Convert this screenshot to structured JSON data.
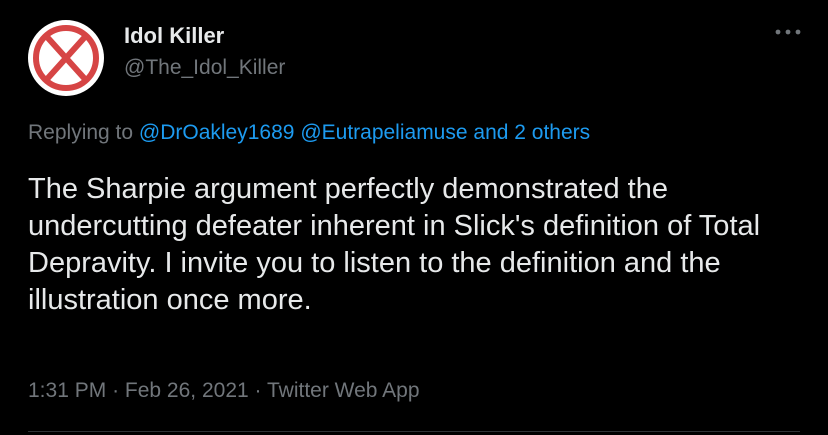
{
  "tweet": {
    "display_name": "Idol Killer",
    "handle": "@The_Idol_Killer",
    "avatar_icon": "red-x-icon",
    "more_icon": "more-options-icon",
    "replying_prefix": "Replying to",
    "reply_mention_1": "@DrOakley1689",
    "reply_mention_2": "@Eutrapeliamuse",
    "reply_others": "and 2 others",
    "text": "The Sharpie argument perfectly demonstrated the undercutting defeater inherent in Slick's definition of Total Depravity. I invite you to listen to the definition and the illustration once more.",
    "time": "1:31 PM",
    "separator": "·",
    "date": "Feb 26, 2021",
    "source": "Twitter Web App"
  },
  "colors": {
    "background": "#000000",
    "primary_text": "#e7e9ea",
    "secondary_text": "#71767b",
    "link": "#1d9bf0",
    "avatar_x": "#d64545"
  }
}
